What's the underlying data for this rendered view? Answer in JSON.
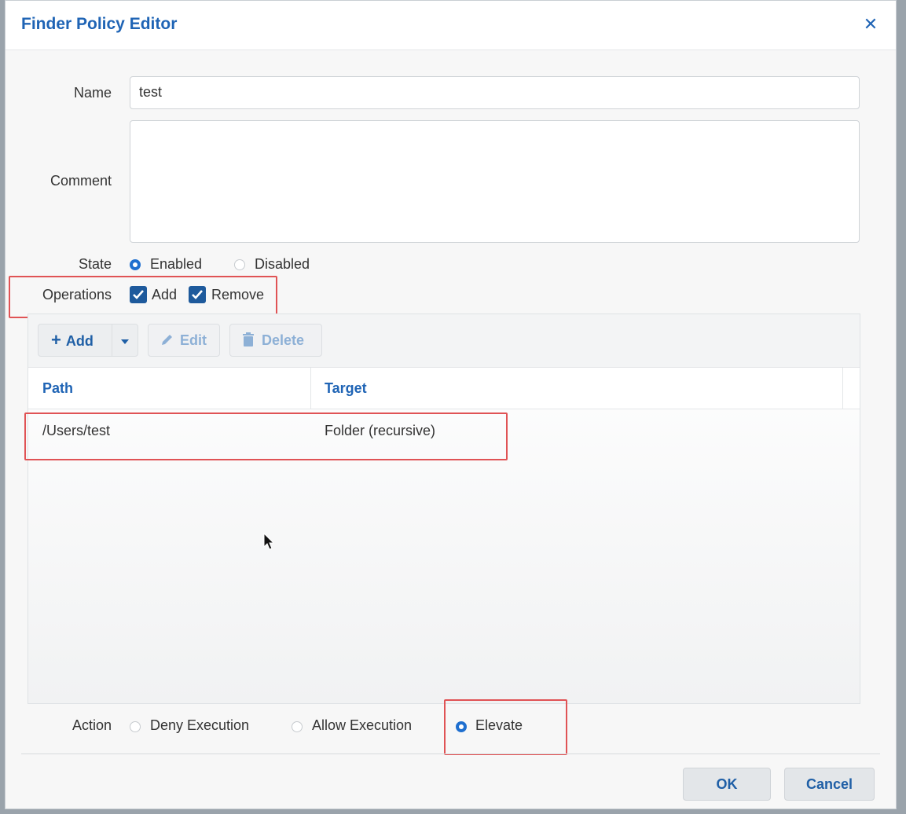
{
  "dialog": {
    "title": "Finder Policy Editor",
    "close_glyph": "✕"
  },
  "form": {
    "name_label": "Name",
    "name_value": "test",
    "comment_label": "Comment",
    "comment_value": "",
    "state_label": "State",
    "state_options": [
      {
        "label": "Enabled",
        "selected": true
      },
      {
        "label": "Disabled",
        "selected": false
      }
    ],
    "operations_label": "Operations",
    "operations": [
      {
        "label": "Add",
        "checked": true
      },
      {
        "label": "Remove",
        "checked": true
      }
    ]
  },
  "toolbar": {
    "add_label": "Add",
    "add_icon": "plus-icon",
    "dropdown_icon": "caret-down-icon",
    "edit_label": "Edit",
    "edit_icon": "pencil-icon",
    "delete_label": "Delete",
    "delete_icon": "trash-icon"
  },
  "table": {
    "columns": [
      "Path",
      "Target"
    ],
    "rows": [
      {
        "path": "/Users/test",
        "target": "Folder (recursive)"
      }
    ]
  },
  "action": {
    "label": "Action",
    "options": [
      {
        "label": "Deny Execution",
        "selected": false
      },
      {
        "label": "Allow Execution",
        "selected": false
      },
      {
        "label": "Elevate",
        "selected": true
      }
    ]
  },
  "footer": {
    "ok_label": "OK",
    "cancel_label": "Cancel"
  },
  "colors": {
    "accent": "#1f64b5",
    "highlight": "#e05355",
    "checkbox": "#1e5a9c"
  }
}
